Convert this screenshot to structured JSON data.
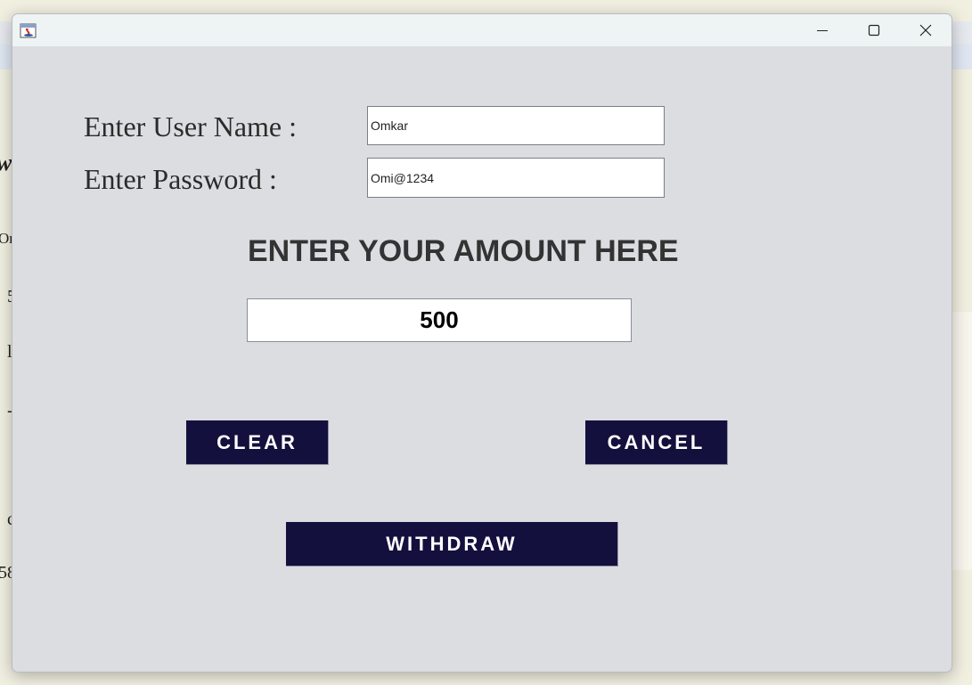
{
  "background_window": {
    "fragments": [
      "w",
      "Or",
      "5",
      "l",
      "-",
      "c",
      "58"
    ]
  },
  "titlebar": {
    "icon": "java-app-icon",
    "controls": {
      "minimize": "minimize-icon",
      "maximize": "maximize-icon",
      "close": "close-icon"
    }
  },
  "form": {
    "username_label": "Enter User Name :",
    "username_value": "Omkar",
    "password_label": "Enter Password :",
    "password_value": "Omi@1234"
  },
  "amount_section": {
    "heading": "ENTER YOUR AMOUNT HERE",
    "amount_value": "500"
  },
  "buttons": {
    "clear": "CLEAR",
    "cancel": "CANCEL",
    "withdraw": "WITHDRAW"
  },
  "colors": {
    "button_bg": "#13103e",
    "button_text": "#ffffff",
    "panel_bg": "#dcdde1"
  }
}
